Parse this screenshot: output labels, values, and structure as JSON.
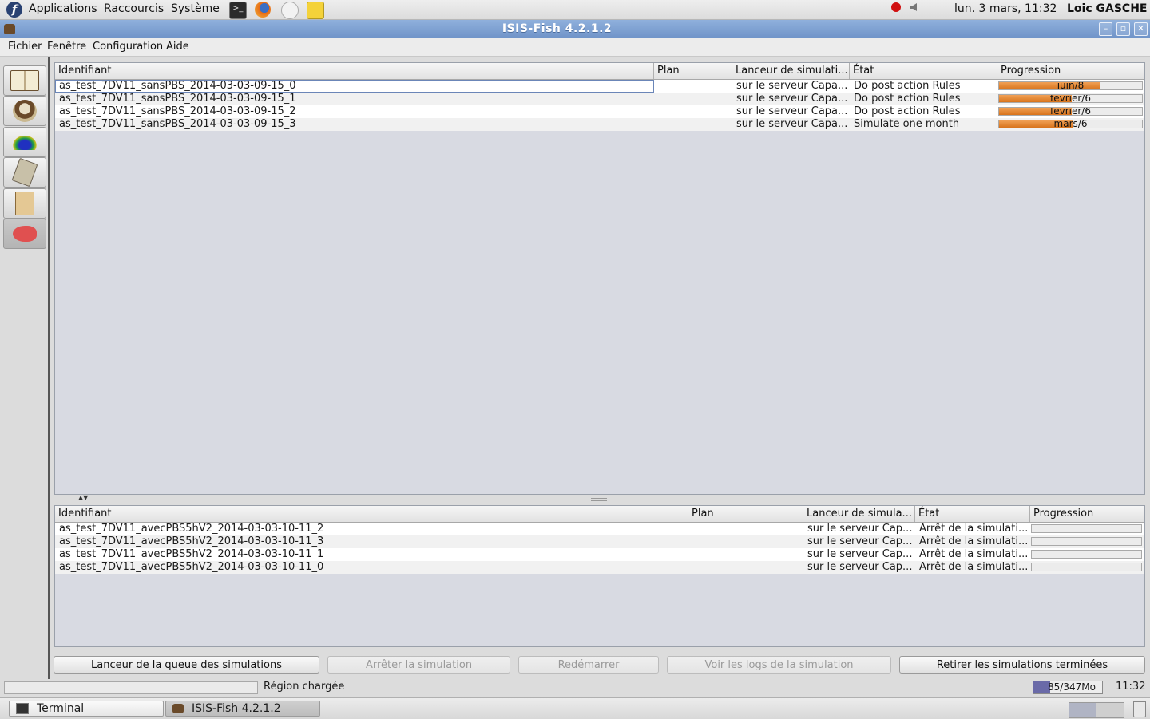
{
  "top_panel": {
    "menus": [
      "Applications",
      "Raccourcis",
      "Système"
    ],
    "clock": "lun.  3 mars, 11:32",
    "user": "Loic GASCHE"
  },
  "window": {
    "title": "ISIS-Fish 4.2.1.2",
    "menu": [
      "Fichier",
      "Fenêtre",
      "Configuration",
      "Aide"
    ]
  },
  "toolbar_icons": [
    "book-icon",
    "fishing-boat-icon",
    "region-map-icon",
    "calculator-icon",
    "scroll-icon",
    "fish-icon"
  ],
  "queue_table": {
    "headers": [
      "Identifiant",
      "Plan",
      "Lanceur de simulati...",
      "État",
      "Progression"
    ],
    "rows": [
      {
        "id": "as_test_7DV11_sansPBS_2014-03-03-09-15_0",
        "plan": "",
        "launcher": "sur le serveur Capa...",
        "state": "Do post action Rules",
        "progress_label": "juin/8",
        "progress": 0.71
      },
      {
        "id": "as_test_7DV11_sansPBS_2014-03-03-09-15_1",
        "plan": "",
        "launcher": "sur le serveur Capa...",
        "state": "Do post action Rules",
        "progress_label": "février/6",
        "progress": 0.51
      },
      {
        "id": "as_test_7DV11_sansPBS_2014-03-03-09-15_2",
        "plan": "",
        "launcher": "sur le serveur Capa...",
        "state": "Do post action Rules",
        "progress_label": "février/6",
        "progress": 0.51
      },
      {
        "id": "as_test_7DV11_sansPBS_2014-03-03-09-15_3",
        "plan": "",
        "launcher": "sur le serveur Capa...",
        "state": "Simulate one month",
        "progress_label": "mars/6",
        "progress": 0.52
      }
    ]
  },
  "done_table": {
    "headers": [
      "Identifiant",
      "Plan",
      "Lanceur de simula...",
      "État",
      "Progression"
    ],
    "rows": [
      {
        "id": "as_test_7DV11_avecPBS5hV2_2014-03-03-10-11_2",
        "plan": "",
        "launcher": "sur le serveur Cap...",
        "state": "Arrêt de la simulati...",
        "progress": 0
      },
      {
        "id": "as_test_7DV11_avecPBS5hV2_2014-03-03-10-11_3",
        "plan": "",
        "launcher": "sur le serveur Cap...",
        "state": "Arrêt de la simulati...",
        "progress": 0
      },
      {
        "id": "as_test_7DV11_avecPBS5hV2_2014-03-03-10-11_1",
        "plan": "",
        "launcher": "sur le serveur Cap...",
        "state": "Arrêt de la simulati...",
        "progress": 0
      },
      {
        "id": "as_test_7DV11_avecPBS5hV2_2014-03-03-10-11_0",
        "plan": "",
        "launcher": "sur le serveur Cap...",
        "state": "Arrêt de la simulati...",
        "progress": 0
      }
    ]
  },
  "buttons": {
    "launch_queue": "Lanceur de la queue des simulations",
    "stop": "Arrêter la simulation",
    "restart": "Redémarrer",
    "logs": "Voir les logs de la simulation",
    "remove_done": "Retirer les simulations terminées"
  },
  "status": {
    "message": "Région chargée",
    "memory": "85/347Mo",
    "memory_fraction": 0.245,
    "time": "11:32"
  },
  "taskbar": {
    "items": [
      "Terminal",
      "ISIS-Fish 4.2.1.2"
    ]
  },
  "colors": {
    "progress_fill": "#e07d2a",
    "titlebar": "#7f9fd0",
    "memory_fill": "#6a6aa8"
  }
}
